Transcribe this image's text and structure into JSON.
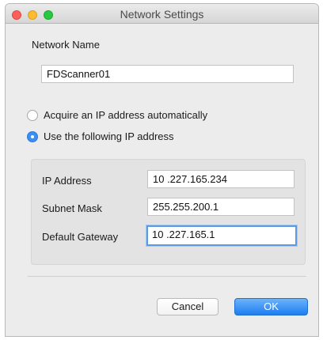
{
  "window": {
    "title": "Network Settings"
  },
  "network_name": {
    "label": "Network Name",
    "value": "FDScanner01"
  },
  "ip_mode": {
    "options": [
      {
        "label": "Acquire an IP address automatically",
        "selected": false
      },
      {
        "label": "Use the following IP address",
        "selected": true
      }
    ]
  },
  "ip_settings": {
    "ip_address": {
      "label": "IP Address",
      "value": "10 .227.165.234"
    },
    "subnet_mask": {
      "label": "Subnet Mask",
      "value": "255.255.200.1"
    },
    "default_gateway": {
      "label": "Default Gateway",
      "value": "10 .227.165.1"
    }
  },
  "buttons": {
    "cancel_label": "Cancel",
    "ok_label": "OK"
  },
  "colors": {
    "accent": "#3a8ef6",
    "close": "#fc5f57",
    "minimize": "#fdbc2e",
    "zoom": "#28c840"
  }
}
